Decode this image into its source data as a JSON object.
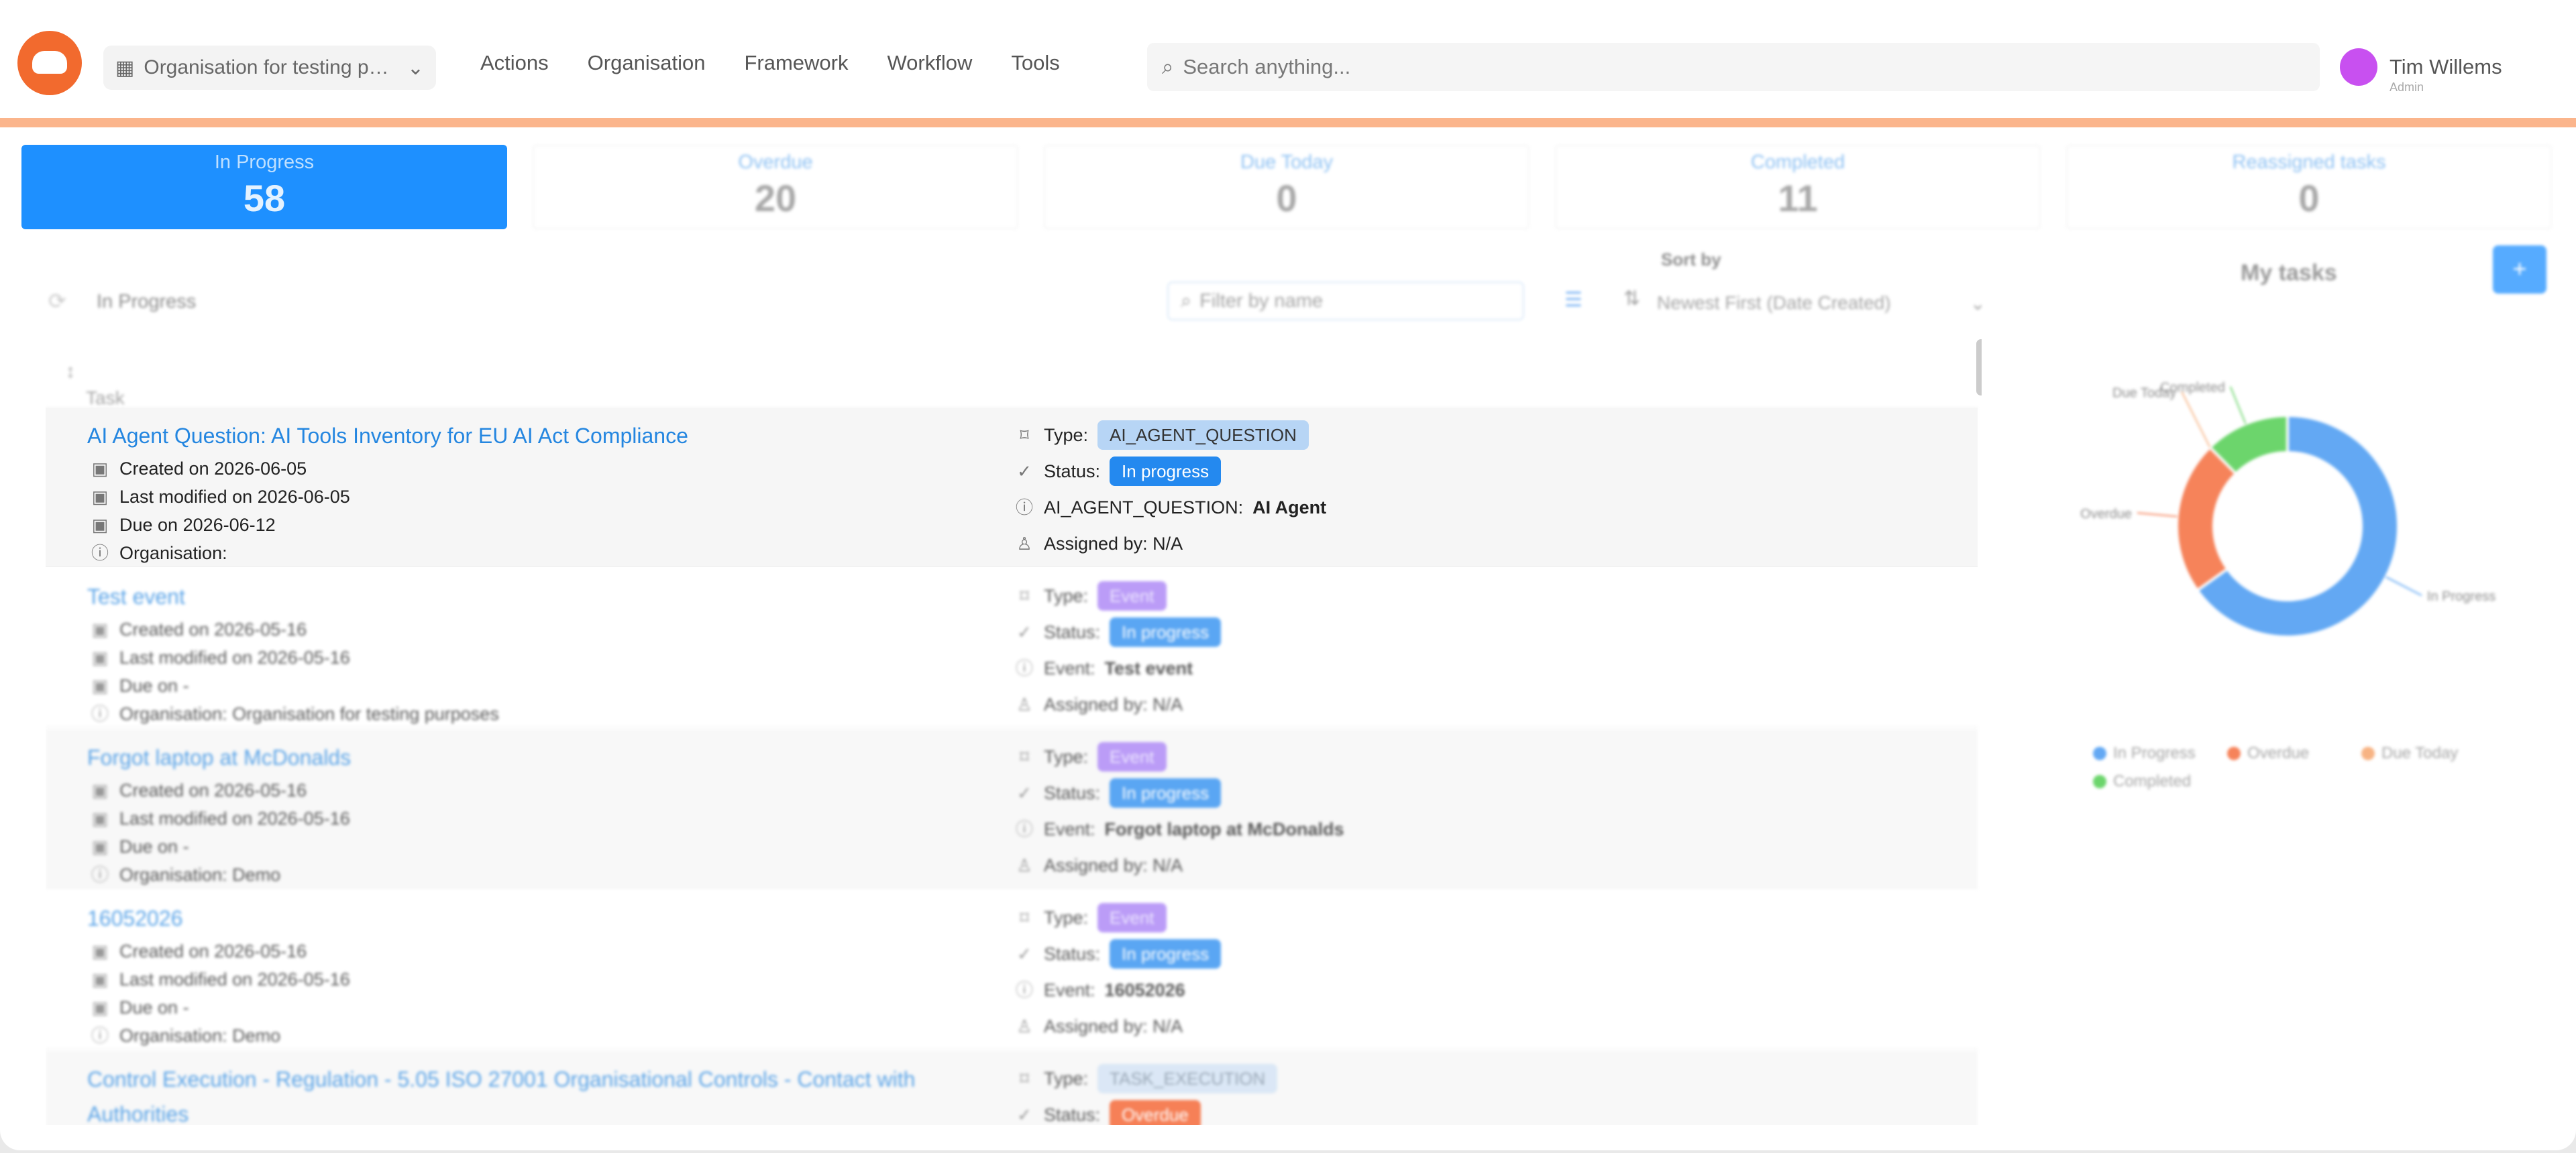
{
  "header": {
    "org": "Organisation for testing purposes",
    "nav": [
      "Actions",
      "Organisation",
      "Framework",
      "Workflow",
      "Tools"
    ],
    "search_placeholder": "Search anything...",
    "user_name": "Tim Willems",
    "user_role": "Admin"
  },
  "stats": [
    {
      "label": "In Progress",
      "value": "58"
    },
    {
      "label": "Overdue",
      "value": "20"
    },
    {
      "label": "Due Today",
      "value": "0"
    },
    {
      "label": "Completed",
      "value": "11"
    },
    {
      "label": "Reassigned tasks",
      "value": "0"
    }
  ],
  "list": {
    "breadcrumb": "In Progress",
    "filter_placeholder": "Filter by name",
    "sort_label": "Sort by",
    "sort_value": "Newest First (Date Created)",
    "column_task": "Task"
  },
  "tasks": [
    {
      "title": "AI Agent Question: AI Tools Inventory for EU AI Act Compliance",
      "created": "Created on 2026-06-05",
      "modified": "Last modified on 2026-06-05",
      "due": "Due on 2026-06-12",
      "org": "Organisation:",
      "type_label": "Type:",
      "type": "AI_AGENT_QUESTION",
      "status_label": "Status:",
      "status": "In progress",
      "extra_key": "AI_AGENT_QUESTION:",
      "extra_val": "AI Agent",
      "assigned": "Assigned by: N/A"
    },
    {
      "title": "Test event",
      "created": "Created on 2026-05-16",
      "modified": "Last modified on 2026-05-16",
      "due": "Due on -",
      "org": "Organisation: Organisation for testing purposes",
      "type_label": "Type:",
      "type": "Event",
      "status_label": "Status:",
      "status": "In progress",
      "extra_key": "Event:",
      "extra_val": "Test event",
      "assigned": "Assigned by: N/A"
    },
    {
      "title": "Forgot laptop at McDonalds",
      "created": "Created on 2026-05-16",
      "modified": "Last modified on 2026-05-16",
      "due": "Due on -",
      "org": "Organisation: Demo",
      "type_label": "Type:",
      "type": "Event",
      "status_label": "Status:",
      "status": "In progress",
      "extra_key": "Event:",
      "extra_val": "Forgot laptop at McDonalds",
      "assigned": "Assigned by: N/A"
    },
    {
      "title": "16052026",
      "created": "Created on 2026-05-16",
      "modified": "Last modified on 2026-05-16",
      "due": "Due on -",
      "org": "Organisation: Demo",
      "type_label": "Type:",
      "type": "Event",
      "status_label": "Status:",
      "status": "In progress",
      "extra_key": "Event:",
      "extra_val": "16052026",
      "assigned": "Assigned by: N/A"
    },
    {
      "title": "Control Execution - Regulation - 5.05 ISO 27001 Organisational Controls - Contact with Authorities",
      "type_label": "Type:",
      "type": "TASK_EXECUTION",
      "status_label": "Status:",
      "status": "Overdue"
    }
  ],
  "panel": {
    "title": "My tasks",
    "add_label": "+"
  },
  "chart_data": {
    "type": "pie",
    "title": "My tasks",
    "categories": [
      "In Progress",
      "Overdue",
      "Due Today",
      "Completed"
    ],
    "values": [
      58,
      20,
      0,
      11
    ],
    "colors": [
      "#2f8cf0",
      "#f35a24",
      "#f59a5a",
      "#3cc83c"
    ],
    "donut": true,
    "legend_position": "bottom"
  }
}
